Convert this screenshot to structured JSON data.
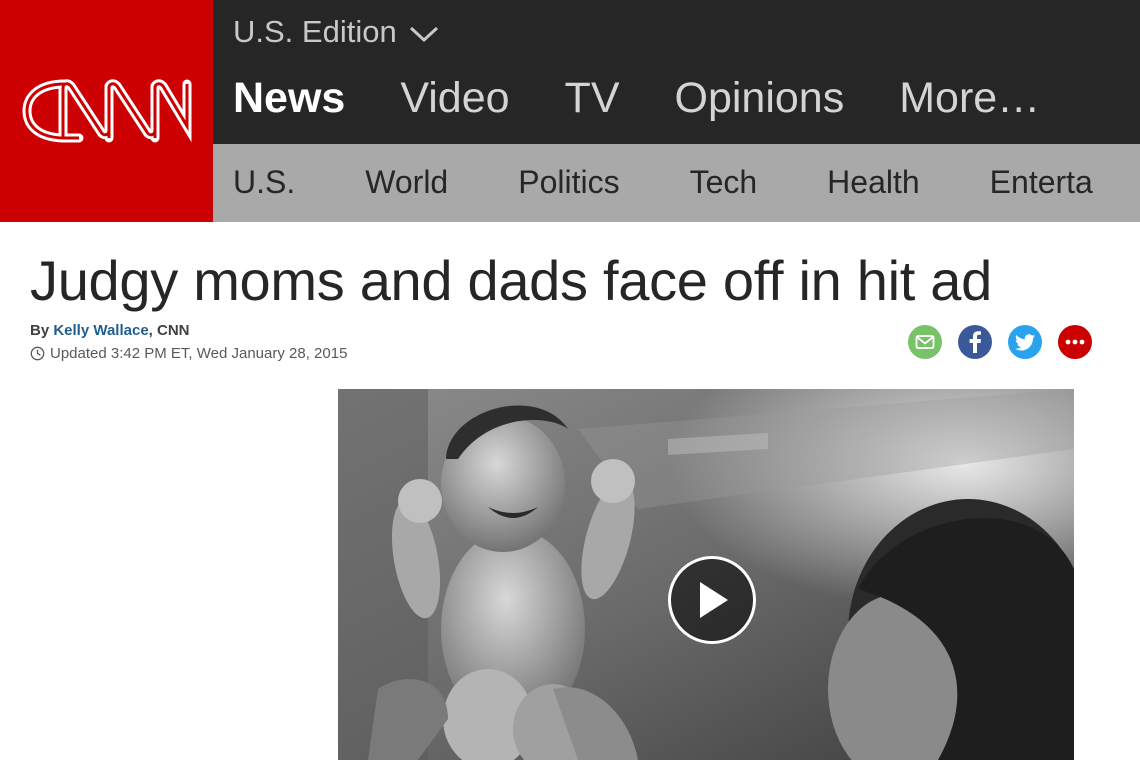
{
  "brand": {
    "logo_text": "CNN",
    "accent_color": "#cc0000"
  },
  "header": {
    "edition_label": "U.S. Edition",
    "main_nav": [
      {
        "label": "News",
        "active": true
      },
      {
        "label": "Video"
      },
      {
        "label": "TV"
      },
      {
        "label": "Opinions"
      },
      {
        "label": "More…"
      }
    ],
    "sub_nav": [
      {
        "label": "U.S."
      },
      {
        "label": "World"
      },
      {
        "label": "Politics"
      },
      {
        "label": "Tech"
      },
      {
        "label": "Health"
      },
      {
        "label": "Enterta"
      }
    ]
  },
  "article": {
    "headline": "Judgy moms and dads face off in hit ad",
    "byline_prefix": "By ",
    "author": "Kelly Wallace",
    "byline_suffix": ", CNN",
    "updated": "Updated 3:42 PM ET, Wed January 28, 2015"
  },
  "share": [
    {
      "name": "email-icon",
      "color": "#78c26a"
    },
    {
      "name": "facebook-icon",
      "color": "#3b5998"
    },
    {
      "name": "twitter-icon",
      "color": "#2aa3ef"
    },
    {
      "name": "more-icon",
      "color": "#cc0000"
    }
  ],
  "video": {
    "icon": "play-icon",
    "style": "black-and-white photo"
  }
}
